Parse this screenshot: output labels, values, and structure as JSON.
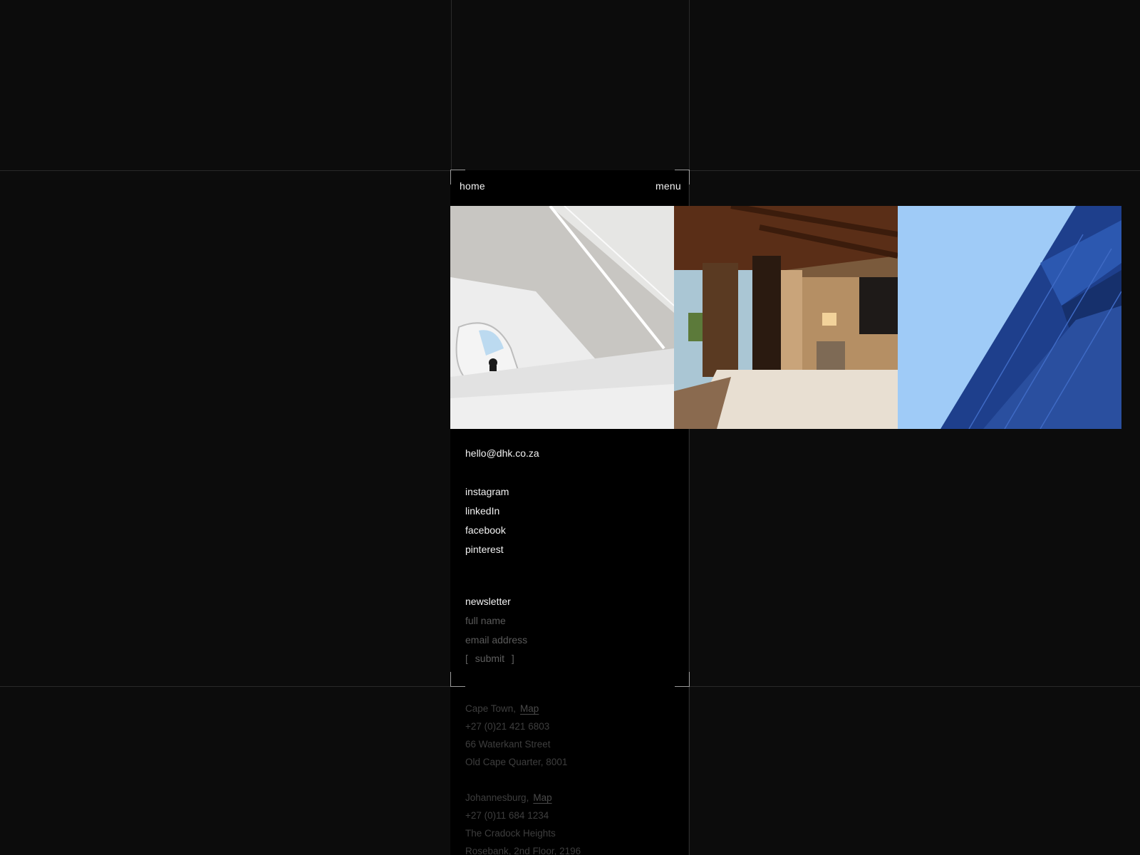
{
  "nav": {
    "home_label": "home",
    "menu_label": "menu"
  },
  "gallery": {
    "images": [
      {
        "name": "white-atrium-interior",
        "colors": {
          "sky": "#9fc9f3",
          "wall": "#e9e9e9"
        }
      },
      {
        "name": "hotel-bedroom-interior",
        "colors": {
          "wood": "#5a2e17",
          "bed": "#e8dfd2"
        }
      },
      {
        "name": "blue-glass-tower",
        "colors": {
          "sky": "#9fcbf7",
          "glass": "#1e3f8c"
        }
      }
    ]
  },
  "contact": {
    "email": "hello@dhk.co.za"
  },
  "social": {
    "instagram": "instagram",
    "linkedin": "linkedIn",
    "facebook": "facebook",
    "pinterest": "pinterest"
  },
  "newsletter": {
    "heading": "newsletter",
    "full_name_placeholder": "full name",
    "email_placeholder": "email address",
    "submit_open": "[",
    "submit_label": "submit",
    "submit_close": "]"
  },
  "offices": [
    {
      "city": "Cape Town,",
      "map_label": "Map",
      "phone": "+27 (0)21 421 6803",
      "line1": "66 Waterkant Street",
      "line2": "Old Cape Quarter, 8001"
    },
    {
      "city": "Johannesburg,",
      "map_label": "Map",
      "phone": "+27 (0)11 684 1234",
      "line1": "The Cradock Heights",
      "line2": "Rosebank, 2nd Floor, 2196"
    }
  ]
}
